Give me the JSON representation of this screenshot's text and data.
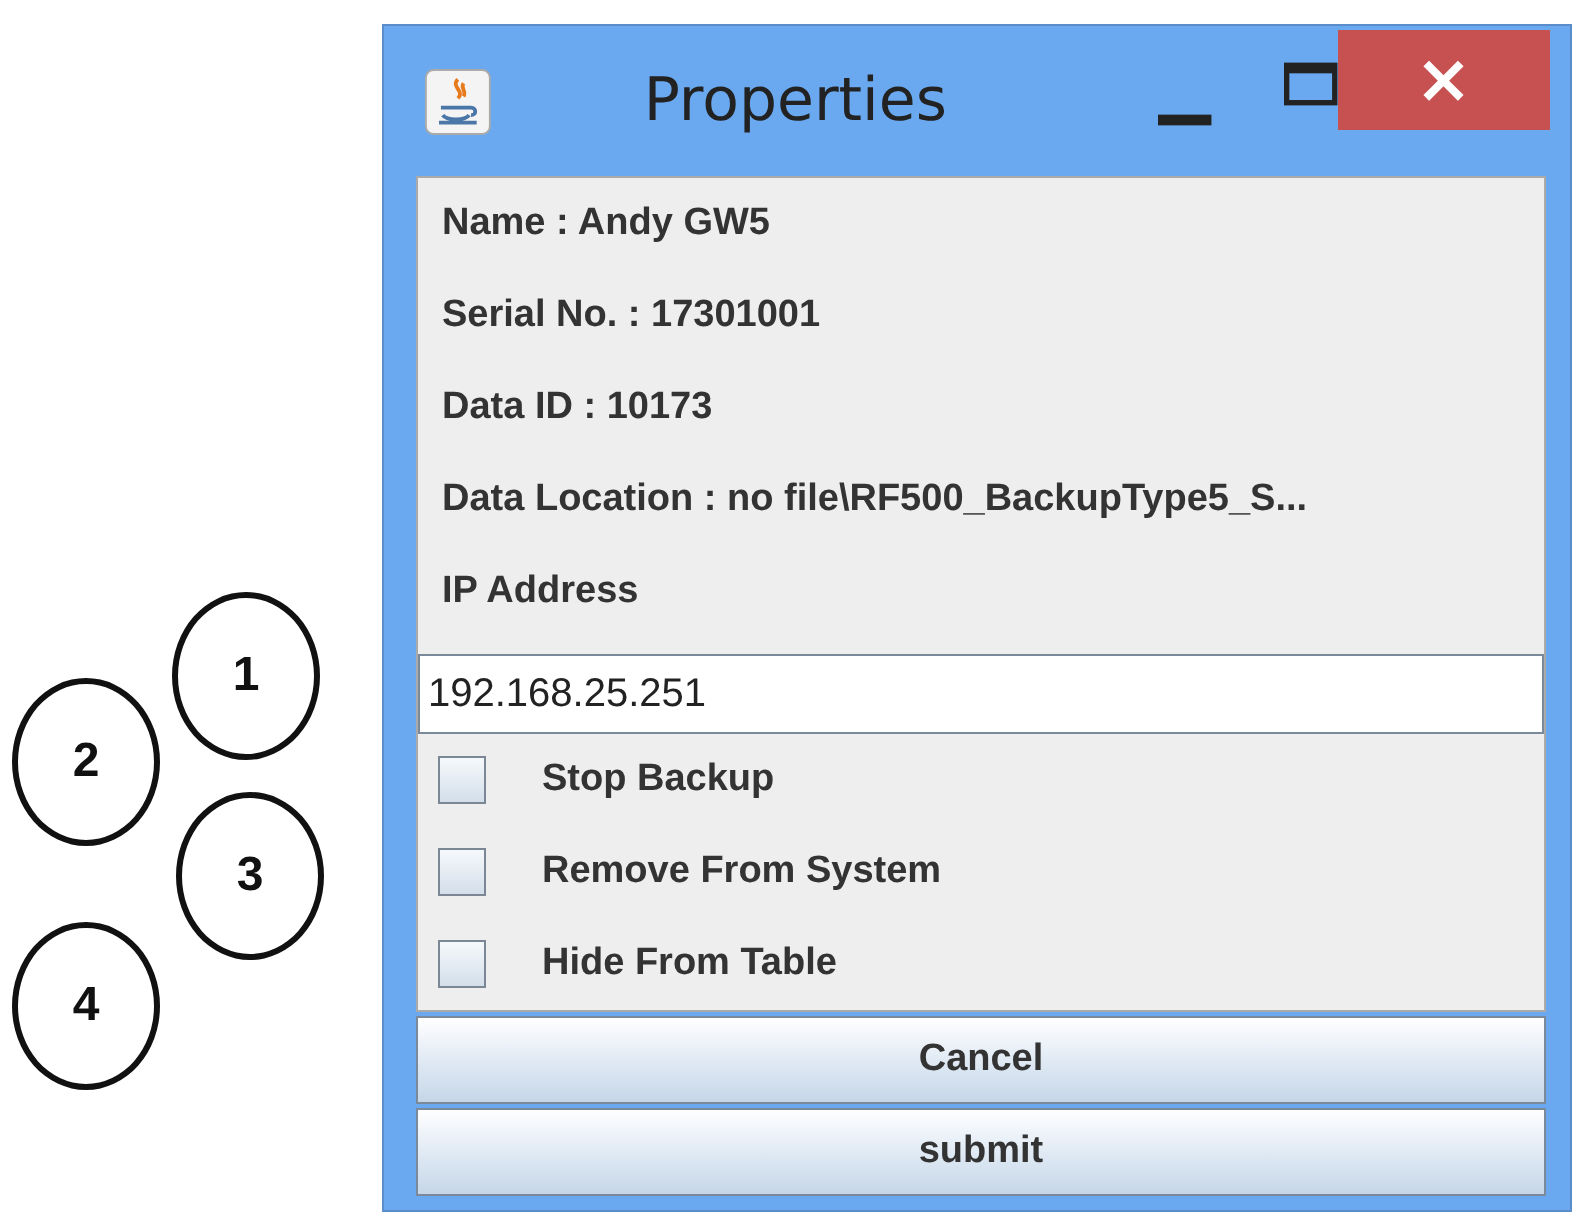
{
  "annotations": [
    "1",
    "2",
    "3",
    "4"
  ],
  "window": {
    "title": "Properties",
    "close": "×"
  },
  "info_lines": [
    "Name :  Andy GW5",
    "Serial No. :  17301001",
    "Data ID :  10173",
    "Data Location :  no file\\RF500_BackupType5_S..."
  ],
  "ip_address": {
    "label": "IP Address",
    "value": "192.168.25.251"
  },
  "options": [
    {
      "label": "Stop Backup",
      "checked": false
    },
    {
      "label": "Remove From System",
      "checked": false
    },
    {
      "label": "Hide From Table",
      "checked": false
    }
  ],
  "buttons": [
    "Cancel",
    "submit"
  ]
}
